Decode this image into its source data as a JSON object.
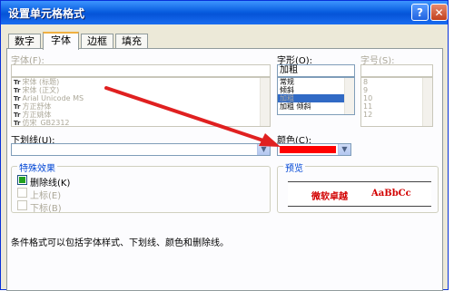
{
  "window": {
    "title": "设置单元格格式",
    "help_icon": "question-mark-icon",
    "close_icon": "close-x-icon"
  },
  "tabs": [
    {
      "label": "数字",
      "active": false
    },
    {
      "label": "字体",
      "active": true
    },
    {
      "label": "边框",
      "active": false
    },
    {
      "label": "填充",
      "active": false
    }
  ],
  "font": {
    "label": "字体(F):",
    "value": "",
    "items": [
      "宋体 (标题)",
      "宋体 (正文)",
      "Arial Unicode MS",
      "方正舒体",
      "方正姚体",
      "仿宋_GB2312"
    ],
    "item_icon": "truetype-font-icon"
  },
  "style": {
    "label": "字形(O):",
    "value": "加粗",
    "items": [
      "常规",
      "倾斜",
      "加粗",
      "加粗 倾斜"
    ],
    "selected_index": 2
  },
  "size": {
    "label": "字号(S):",
    "value": "",
    "items": [
      "8",
      "9",
      "10",
      "11",
      "12"
    ]
  },
  "underline": {
    "label": "下划线(U):",
    "value": ""
  },
  "color": {
    "label": "颜色(C):",
    "value_color": "#ff0000"
  },
  "effects": {
    "title": "特殊效果",
    "options": [
      {
        "label": "删除线(K)",
        "checked": true,
        "enabled": true
      },
      {
        "label": "上标(E)",
        "checked": false,
        "enabled": false
      },
      {
        "label": "下标(B)",
        "checked": false,
        "enabled": false
      }
    ]
  },
  "preview": {
    "title": "预览",
    "text_cn": "微软卓越",
    "text_en": "AaBbCc",
    "text_color": "#d20000"
  },
  "note": "条件格式可以包括字体样式、下划线、颜色和删除线。",
  "annotation": {
    "arrow_color": "#e02020"
  }
}
